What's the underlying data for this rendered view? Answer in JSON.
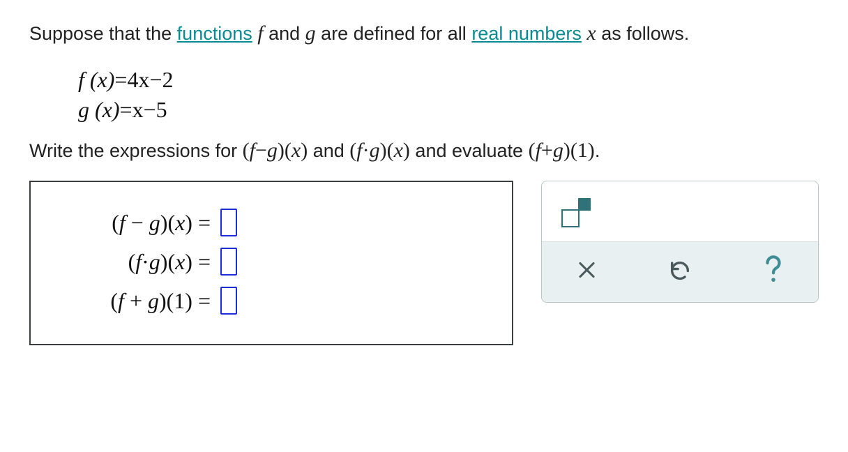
{
  "intro": {
    "pre": "Suppose that the ",
    "link1": "functions",
    "mid1": " ",
    "f": "f",
    "mid2": " and ",
    "g": "g",
    "mid3": " are defined for all ",
    "link2": "real numbers",
    "mid4": " ",
    "x": "x",
    "post": " as follows."
  },
  "defs": {
    "line1_lhs": "f (x)",
    "line1_eq": "=",
    "line1_rhs": "4x−2",
    "line2_lhs": "g (x)",
    "line2_eq": "=",
    "line2_rhs": "x−5"
  },
  "task": {
    "pre": "Write the expressions for ",
    "e1": "(f−g)(x)",
    "mid1": " and ",
    "e2": "(f·g)(x)",
    "mid2": " and evaluate ",
    "e3": "(f+g)(1)",
    "post": "."
  },
  "answers": {
    "row1": "(f − g)(x) = ",
    "row2": "(f·g)(x) = ",
    "row3": "(f + g)(1) = "
  },
  "tools": {
    "exponent": "exponent",
    "clear": "clear",
    "undo": "undo",
    "help": "help"
  }
}
